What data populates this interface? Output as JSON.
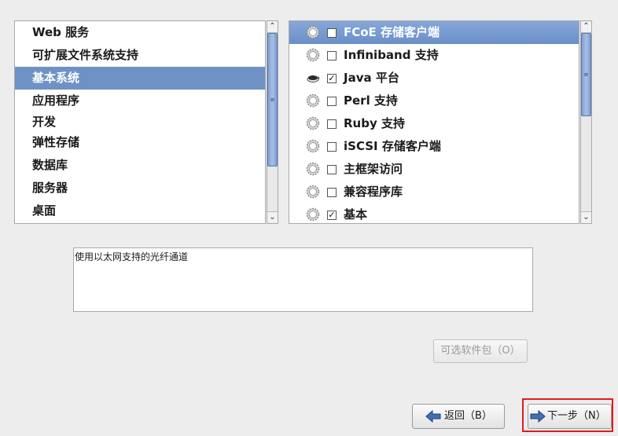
{
  "categories": {
    "items": [
      {
        "label": "Web 服务",
        "selected": false
      },
      {
        "label": "可扩展文件系统支持",
        "selected": false
      },
      {
        "label": "基本系统",
        "selected": true
      },
      {
        "label": "应用程序",
        "selected": false
      },
      {
        "label": "开发",
        "selected": false
      },
      {
        "label": "弹性存储",
        "selected": false
      },
      {
        "label": "数据库",
        "selected": false
      },
      {
        "label": "服务器",
        "selected": false
      },
      {
        "label": "桌面",
        "selected": false
      }
    ]
  },
  "packages": {
    "items": [
      {
        "label": "FCoE 存储客户端",
        "checked": false,
        "icon": "gear-icon",
        "selected": true
      },
      {
        "label": "Infiniband 支持",
        "checked": false,
        "icon": "gear-icon",
        "selected": false
      },
      {
        "label": "Java 平台",
        "checked": true,
        "icon": "coffee-cup-icon",
        "selected": false
      },
      {
        "label": "Perl 支持",
        "checked": false,
        "icon": "gear-icon",
        "selected": false
      },
      {
        "label": "Ruby 支持",
        "checked": false,
        "icon": "gear-icon",
        "selected": false
      },
      {
        "label": "iSCSI 存储客户端",
        "checked": false,
        "icon": "gear-icon",
        "selected": false
      },
      {
        "label": "主框架访问",
        "checked": false,
        "icon": "gear-icon",
        "selected": false
      },
      {
        "label": "兼容程序库",
        "checked": false,
        "icon": "gear-icon",
        "selected": false
      },
      {
        "label": "基本",
        "checked": true,
        "icon": "gear-icon",
        "selected": false
      }
    ]
  },
  "description": {
    "text": "使用以太网支持的光纤通道"
  },
  "buttons": {
    "optional_packages": "可选软件包（O）",
    "back": "返回（B）",
    "next": "下一步（N）"
  },
  "colors": {
    "selection": "#6f92c6",
    "highlight_border": "#e01b1b",
    "scroll_thumb": "#8aa8d8"
  }
}
